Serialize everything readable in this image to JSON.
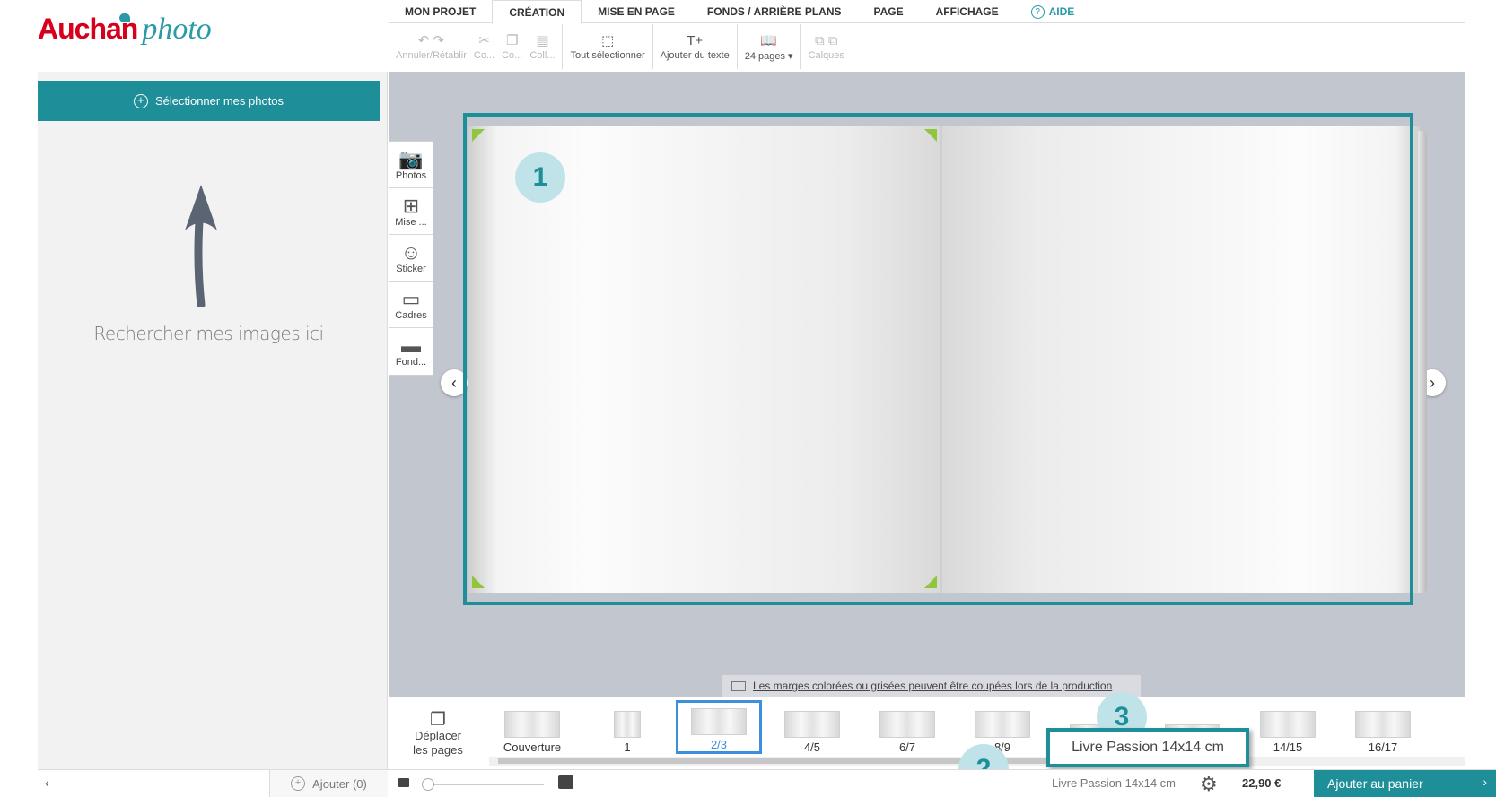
{
  "brand": {
    "name_part1": "Auchan",
    "name_part2": "photo",
    "accent": "#1e8f99",
    "brand_red": "#d6001c"
  },
  "menu": {
    "items": [
      {
        "label": "MON PROJET"
      },
      {
        "label": "CRÉATION"
      },
      {
        "label": "MISE EN PAGE"
      },
      {
        "label": "FONDS / ARRIÈRE PLANS"
      },
      {
        "label": "PAGE"
      },
      {
        "label": "AFFICHAGE"
      }
    ],
    "help_label": "AIDE",
    "help_icon": "?"
  },
  "toolbar": {
    "undo_redo": "Annuler/Rétablir",
    "cut": "Co...",
    "copy": "Co...",
    "paste": "Coll...",
    "select_all": "Tout sélectionner",
    "add_text": "Ajouter du texte",
    "pages": "24 pages",
    "layers": "Calques"
  },
  "left_panel": {
    "select_button": "Sélectionner mes photos",
    "upload_hint": "Rechercher mes images ici"
  },
  "side_tools": [
    {
      "label": "Photos",
      "icon": "camera-icon"
    },
    {
      "label": "Mise ...",
      "icon": "layout-icon"
    },
    {
      "label": "Sticker",
      "icon": "smiley-icon"
    },
    {
      "label": "Cadres",
      "icon": "frame-icon"
    },
    {
      "label": "Fond...",
      "icon": "background-icon"
    }
  ],
  "badges": {
    "b1": "1",
    "b2": "2",
    "b3": "3"
  },
  "warning": "Les marges colorées ou grisées peuvent être coupées lors de la production",
  "filmstrip": {
    "move_label_1": "Déplacer",
    "move_label_2": "les pages",
    "pages": [
      "Couverture",
      "1",
      "2/3",
      "4/5",
      "6/7",
      "8/9",
      "",
      "",
      "14/15",
      "16/17"
    ],
    "active_index": 2
  },
  "tooltip": "Livre Passion 14x14 cm",
  "bottom": {
    "add_label": "Ajouter (0)",
    "product": "Livre Passion 14x14 cm",
    "price": "22,90 €",
    "cart_label": "Ajouter au panier"
  }
}
